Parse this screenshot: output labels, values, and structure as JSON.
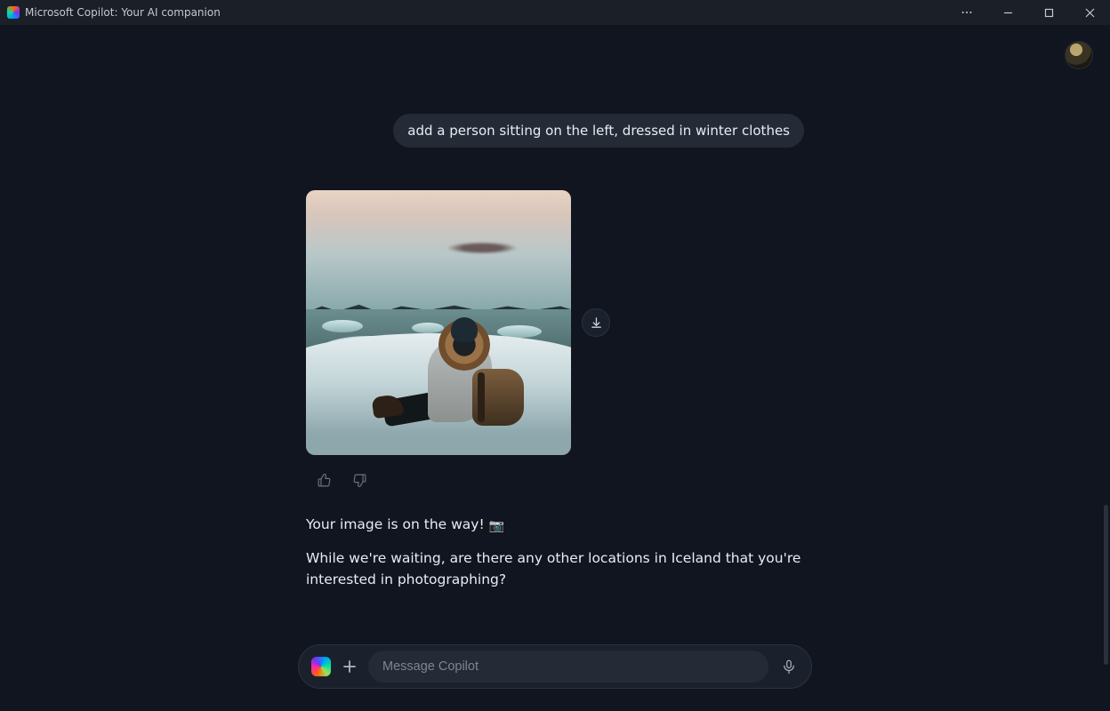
{
  "titlebar": {
    "title": "Microsoft Copilot: Your AI companion"
  },
  "user_message": "add a person sitting on the left, dressed in winter clothes",
  "assistant": {
    "status_line": "Your image is on the way!",
    "status_emoji": "📷",
    "followup": "While we're waiting, are there any other locations in Iceland that you're interested in photographing?"
  },
  "input": {
    "placeholder": "Message Copilot"
  },
  "icons": {
    "more": "more-icon",
    "minimize": "minimize-icon",
    "maximize": "maximize-icon",
    "close": "close-icon",
    "download": "download-icon",
    "thumbs_up": "thumbs-up-icon",
    "thumbs_down": "thumbs-down-icon",
    "plus": "plus-icon",
    "mic": "microphone-icon",
    "copilot": "copilot-logo-icon",
    "avatar": "user-avatar"
  }
}
